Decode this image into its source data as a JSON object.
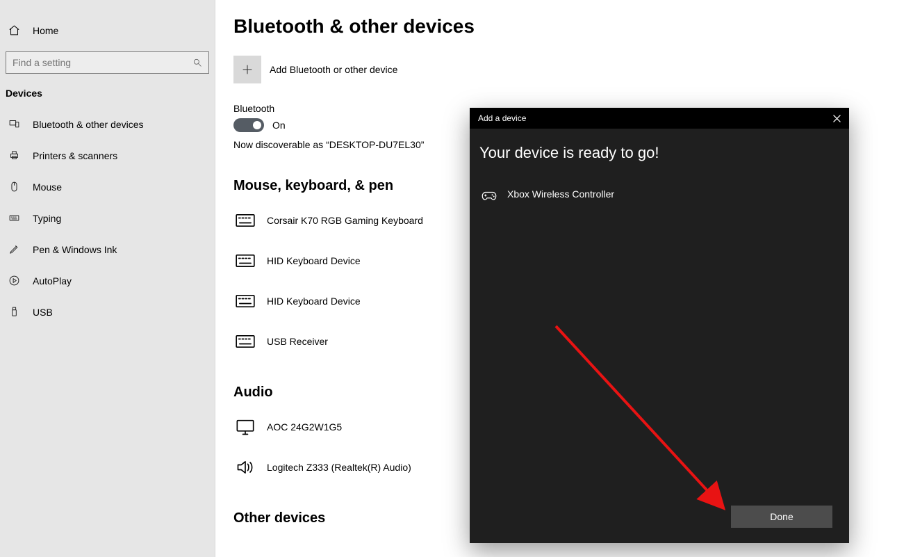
{
  "sidebar": {
    "home_label": "Home",
    "search_placeholder": "Find a setting",
    "section_label": "Devices",
    "items": [
      {
        "label": "Bluetooth & other devices"
      },
      {
        "label": "Printers & scanners"
      },
      {
        "label": "Mouse"
      },
      {
        "label": "Typing"
      },
      {
        "label": "Pen & Windows Ink"
      },
      {
        "label": "AutoPlay"
      },
      {
        "label": "USB"
      }
    ]
  },
  "main": {
    "page_title": "Bluetooth & other devices",
    "add_label": "Add Bluetooth or other device",
    "bluetooth_label": "Bluetooth",
    "bluetooth_state": "On",
    "discoverable_text": "Now discoverable as “DESKTOP-DU7EL30”",
    "group_mouse_title": "Mouse, keyboard, & pen",
    "devices_mouse": [
      "Corsair K70 RGB Gaming Keyboard",
      "HID Keyboard Device",
      "HID Keyboard Device",
      "USB Receiver"
    ],
    "group_audio_title": "Audio",
    "devices_audio": [
      "AOC 24G2W1G5",
      "Logitech Z333 (Realtek(R) Audio)"
    ],
    "group_other_title": "Other devices"
  },
  "dialog": {
    "titlebar": "Add a device",
    "heading": "Your device is ready to go!",
    "device_name": "Xbox Wireless Controller",
    "done_label": "Done"
  }
}
